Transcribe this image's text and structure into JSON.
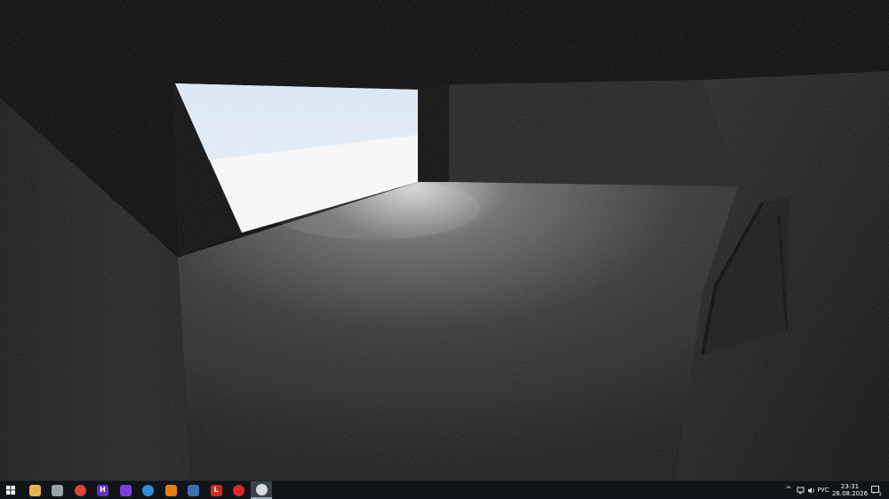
{
  "taskbar": {
    "apps": [
      {
        "name": "file-explorer-icon",
        "color": "#e6b34a",
        "glyph": ""
      },
      {
        "name": "files-app-icon",
        "color": "#9aa3ad",
        "glyph": ""
      },
      {
        "name": "chrome-icon",
        "color": "#db4437",
        "glyph": ""
      },
      {
        "name": "hoi4-app-icon",
        "color": "#6b2fbf",
        "glyph": "H"
      },
      {
        "name": "github-desktop-icon",
        "color": "#7b3fe0",
        "glyph": ""
      },
      {
        "name": "browser-globe-icon",
        "color": "#2f8fd8",
        "glyph": ""
      },
      {
        "name": "blender-icon",
        "color": "#e87d0d",
        "glyph": ""
      },
      {
        "name": "editor-app-icon",
        "color": "#3d6fb5",
        "glyph": ""
      },
      {
        "name": "app-l-icon",
        "color": "#d42a1c",
        "glyph": "L"
      },
      {
        "name": "record-icon",
        "color": "#e02525",
        "glyph": ""
      },
      {
        "name": "unity-icon",
        "color": "#d9dde2",
        "glyph": ""
      }
    ],
    "tray": {
      "language": "РУС",
      "time": "23:31",
      "date": "26.08.2026",
      "notification_count": "1"
    }
  }
}
